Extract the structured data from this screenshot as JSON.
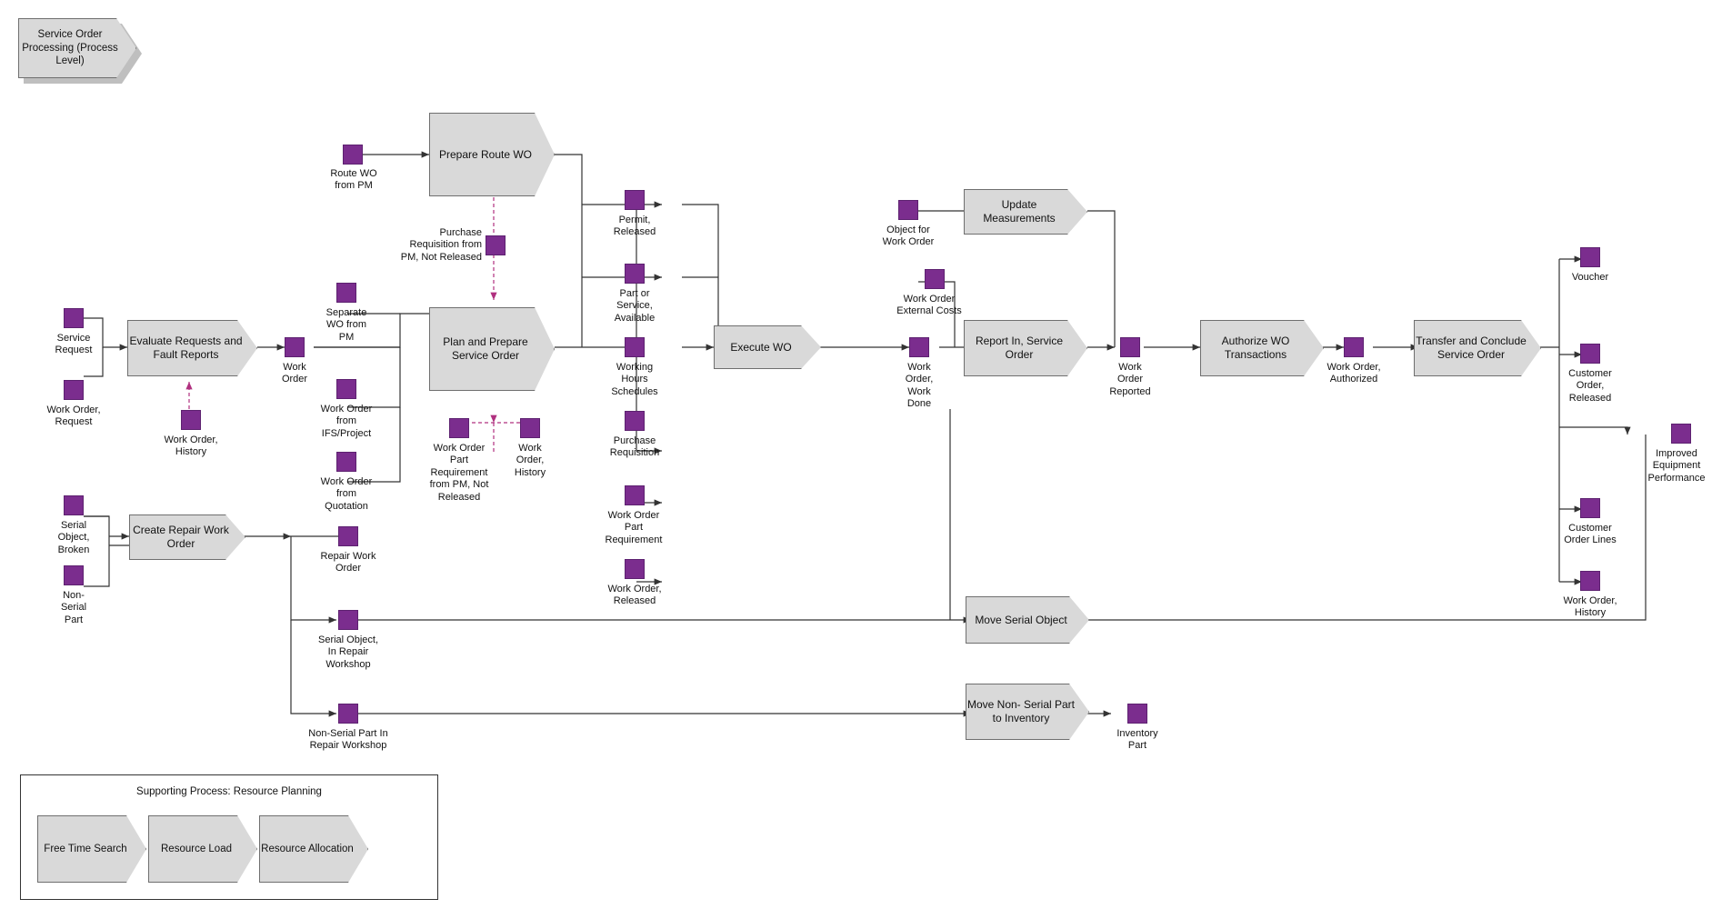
{
  "diagram": {
    "title": "Service Order\nProcessing\n(Process Level)",
    "processes": [
      {
        "id": "prepare-route-wo",
        "label": "Prepare Route\nWO"
      },
      {
        "id": "evaluate-requests",
        "label": "Evaluate\nRequests and\nFault Reports"
      },
      {
        "id": "plan-prepare-service-order",
        "label": "Plan and\nPrepare\nService Order"
      },
      {
        "id": "execute-wo",
        "label": "Execute WO"
      },
      {
        "id": "update-measurements",
        "label": "Update\nMeasurements"
      },
      {
        "id": "report-in-service-order",
        "label": "Report In,\nService Order"
      },
      {
        "id": "authorize-wo-transactions",
        "label": "Authorize WO\nTransactions"
      },
      {
        "id": "transfer-conclude-service-order",
        "label": "Transfer and\nConclude\nService Order"
      },
      {
        "id": "create-repair-work-order",
        "label": "Create Repair\nWork Order"
      },
      {
        "id": "move-serial-object",
        "label": "Move Serial\nObject"
      },
      {
        "id": "move-non-serial-part-to-inventory",
        "label": "Move Non-\nSerial Part to\nInventory"
      }
    ],
    "objects": [
      {
        "id": "route-wo-from-pm",
        "label": "Route WO\nfrom PM"
      },
      {
        "id": "purchase-requisition-from-pm-not-released",
        "label": "Purchase\nRequisition from\nPM, Not Released"
      },
      {
        "id": "permit-released",
        "label": "Permit,\nReleased"
      },
      {
        "id": "part-or-service-available",
        "label": "Part or\nService,\nAvailable"
      },
      {
        "id": "working-hours-schedules",
        "label": "Working\nHours\nSchedules"
      },
      {
        "id": "purchase-requisition",
        "label": "Purchase\nRequisition"
      },
      {
        "id": "work-order-part-requirement",
        "label": "Work Order\nPart\nRequirement"
      },
      {
        "id": "work-order-released",
        "label": "Work Order,\nReleased"
      },
      {
        "id": "object-for-work-order",
        "label": "Object for\nWork Order"
      },
      {
        "id": "work-order-external-costs",
        "label": "Work Order\nExternal Costs"
      },
      {
        "id": "work-order-work-done",
        "label": "Work\nOrder,\nWork\nDone"
      },
      {
        "id": "work-order-reported",
        "label": "Work\nOrder\nReported"
      },
      {
        "id": "work-order-authorized",
        "label": "Work Order,\nAuthorized"
      },
      {
        "id": "voucher",
        "label": "Voucher"
      },
      {
        "id": "customer-order-released",
        "label": "Customer\nOrder,\nReleased"
      },
      {
        "id": "improved-equipment-performance",
        "label": "Improved\nEquipment\nPerformance"
      },
      {
        "id": "customer-order-lines",
        "label": "Customer\nOrder Lines"
      },
      {
        "id": "work-order-history-right",
        "label": "Work Order,\nHistory"
      },
      {
        "id": "service-request",
        "label": "Service\nRequest"
      },
      {
        "id": "work-order-request",
        "label": "Work Order,\nRequest"
      },
      {
        "id": "work-order-history-left",
        "label": "Work Order,\nHistory"
      },
      {
        "id": "work-order",
        "label": "Work\nOrder"
      },
      {
        "id": "separate-wo-from-pm",
        "label": "Separate\nWO from\nPM"
      },
      {
        "id": "work-order-from-ifs-project",
        "label": "Work Order\nfrom\nIFS/Project"
      },
      {
        "id": "work-order-from-quotation",
        "label": "Work Order\nfrom\nQuotation"
      },
      {
        "id": "work-order-part-requirement-from-pm-not-released",
        "label": "Work Order\nPart\nRequirement\nfrom PM, Not\nReleased"
      },
      {
        "id": "work-order-history-center",
        "label": "Work\nOrder,\nHistory"
      },
      {
        "id": "serial-object-broken",
        "label": "Serial\nObject,\nBroken"
      },
      {
        "id": "non-serial-part",
        "label": "Non-\nSerial\nPart"
      },
      {
        "id": "repair-work-order",
        "label": "Repair Work\nOrder"
      },
      {
        "id": "serial-object-in-repair-workshop",
        "label": "Serial Object,\nIn Repair\nWorkshop"
      },
      {
        "id": "non-serial-part-in-repair-workshop",
        "label": "Non-Serial Part In\nRepair Workshop"
      },
      {
        "id": "inventory-part",
        "label": "Inventory\nPart"
      }
    ],
    "supporting_panel": {
      "title": "Supporting Process: Resource Planning",
      "items": [
        {
          "id": "free-time-search",
          "label": "Free Time\nSearch"
        },
        {
          "id": "resource-load",
          "label": "Resource Load"
        },
        {
          "id": "resource-allocation",
          "label": "Resource\nAllocation"
        }
      ]
    },
    "colors": {
      "node": "#7b2d8e",
      "process_fill": "#d9d9d9",
      "process_border": "#6f6f6f",
      "line": "#333333",
      "dashed": "#b0307f"
    }
  }
}
